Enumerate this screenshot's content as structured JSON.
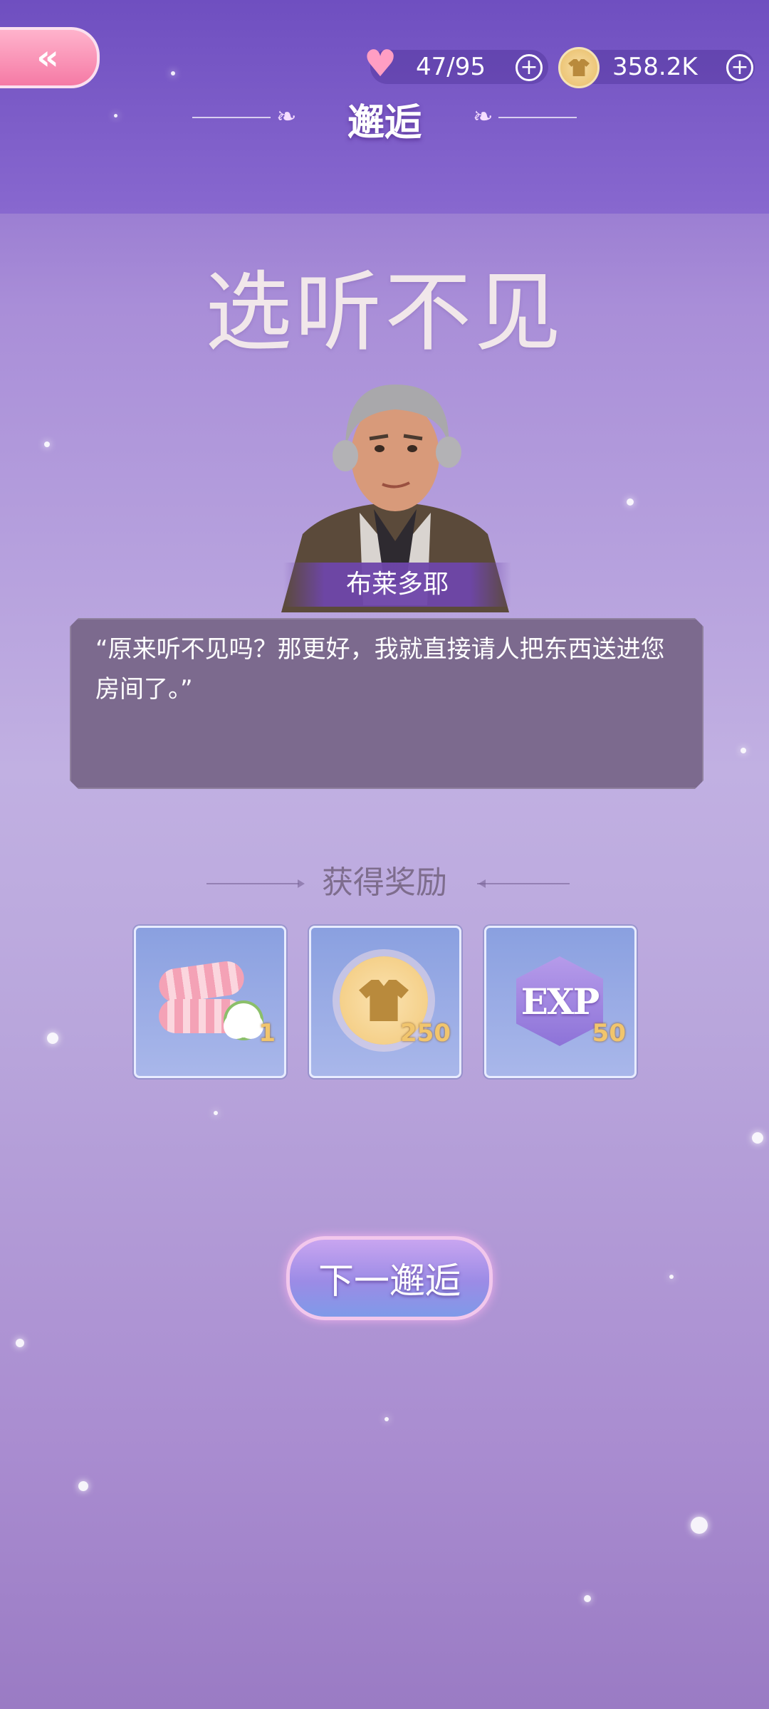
{
  "header": {
    "title": "邂逅",
    "back_icon": "double-chevron-left-icon"
  },
  "resources": {
    "stamina": {
      "icon": "heart-icon",
      "value": "47/95"
    },
    "currency": {
      "icon": "coin-shirt-icon",
      "value": "358.2K"
    }
  },
  "encounter": {
    "title": "选听不见",
    "character_name": "布莱多耶",
    "dialog": "“原来听不见吗？那更好，我就直接请人把东西送进您房间了。”"
  },
  "rewards": {
    "label": "获得奖励",
    "items": [
      {
        "icon": "towel-cotton-icon",
        "count": "1"
      },
      {
        "icon": "coin-shirt-icon",
        "count": "250"
      },
      {
        "icon": "exp-icon",
        "text": "EXP",
        "count": "50"
      }
    ]
  },
  "actions": {
    "next_label": "下一邂逅"
  },
  "colors": {
    "background_top": "#7e5cc6",
    "dialog_bg": "#7c6a8e",
    "reward_count": "#f1c56d",
    "back_button": "#f57aa5"
  }
}
